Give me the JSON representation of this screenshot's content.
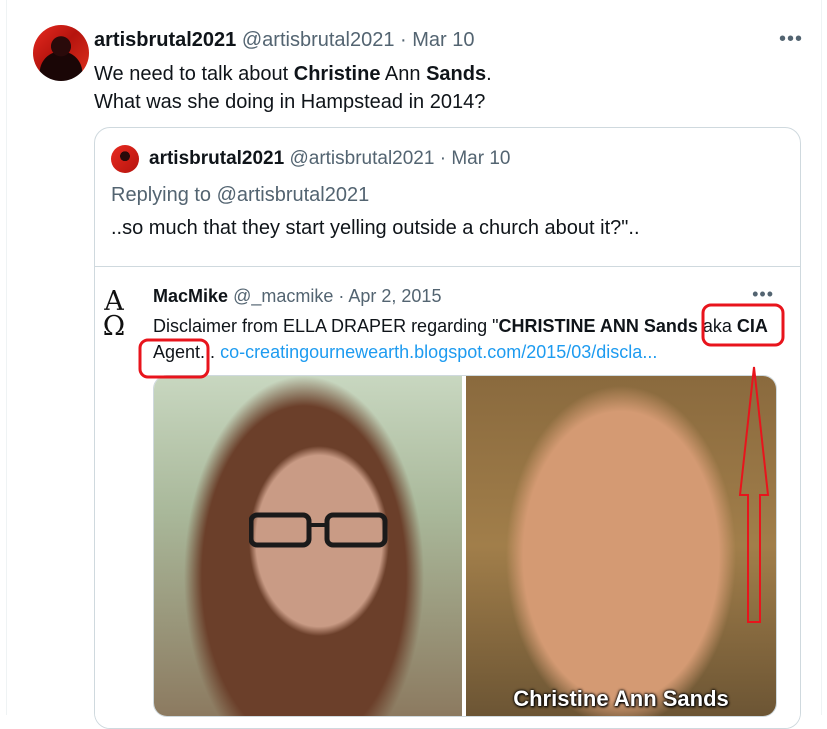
{
  "tweet": {
    "author_name": "artisbrutal2021",
    "author_handle": "@artisbrutal2021",
    "separator": "·",
    "date": "Mar 10",
    "more_icon": "•••",
    "line1_a": "We need to talk about ",
    "line1_b": "Christine",
    "line1_c": " Ann ",
    "line1_d": "Sands",
    "line1_e": ".",
    "line2": "What was she doing in Hampstead in 2014?"
  },
  "quote": {
    "author_name": "artisbrutal2021",
    "author_handle": "@artisbrutal2021",
    "separator": "·",
    "date": "Mar 10",
    "replying_to": "Replying to @artisbrutal2021",
    "text": "..so much that they start yelling outside a church about it?\".."
  },
  "inner": {
    "logo_top": "A",
    "logo_bottom": "Ω",
    "author_name": "MacMike",
    "author_handle": "@_macmike",
    "separator": "·",
    "date": "Apr 2, 2015",
    "more_icon": "•••",
    "text_a": "Disclaimer from ELLA DRAPER regarding \"",
    "text_b": "CHRISTINE ANN Sands",
    "text_c": " aka ",
    "text_d": "CIA",
    "text_e": "Agent",
    "text_f": "... ",
    "link": "co-creatingournewearth.blogspot.com/2015/03/discla...",
    "caption": "Christine Ann Sands"
  },
  "annotation_color": "#e8141c"
}
